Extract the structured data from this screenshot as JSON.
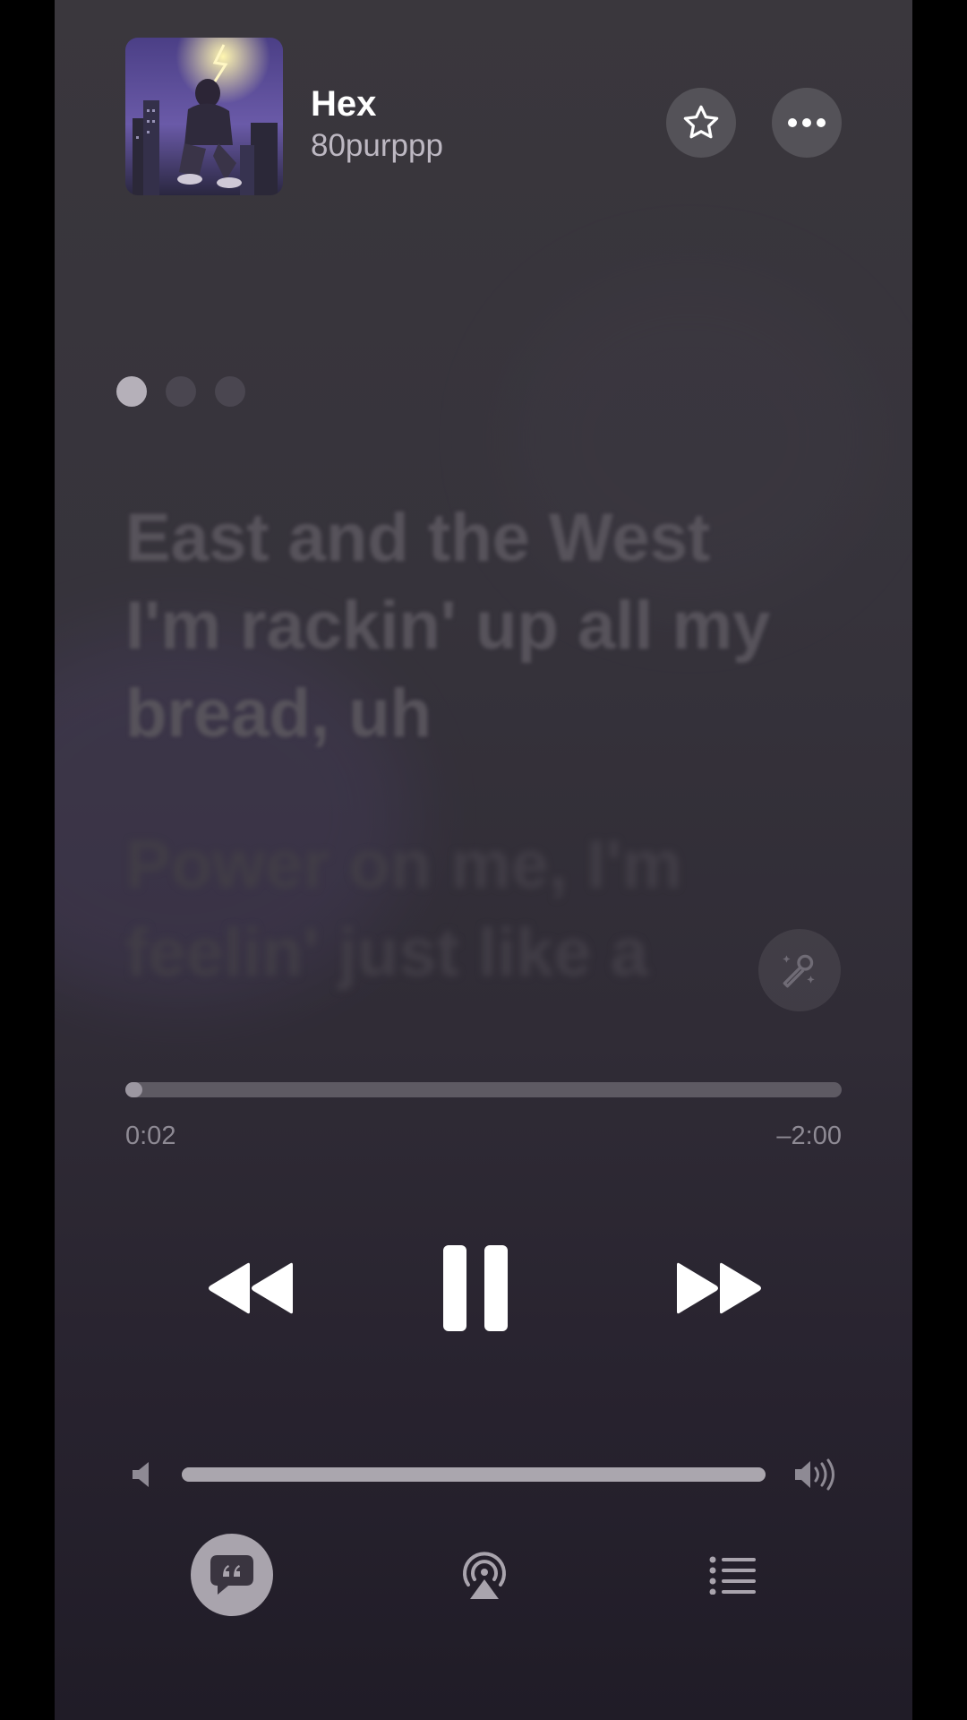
{
  "track": {
    "title": "Hex",
    "artist": "80purppp"
  },
  "header": {
    "favorite_icon": "star-icon",
    "more_icon": "ellipsis-icon"
  },
  "lyrics": {
    "current_line": "East and the West I'm rackin' up all my bread, uh",
    "next_line": "Power on me, I'm feelin' just like a"
  },
  "page_indicator": {
    "count": 3,
    "active_index": 0
  },
  "playback": {
    "elapsed": "0:02",
    "remaining": "–2:00",
    "progress_fraction": 0.02
  },
  "controls": {
    "previous_icon": "rewind-icon",
    "play_pause_icon": "pause-icon",
    "next_icon": "fast-forward-icon"
  },
  "volume": {
    "level_fraction": 1.0
  },
  "bottom_bar": {
    "lyrics_icon": "lyrics-quote-icon",
    "airplay_icon": "airplay-icon",
    "queue_icon": "queue-list-icon"
  },
  "colors": {
    "background": "#36333b",
    "accent_text": "#ffffff",
    "secondary_text": "#bdb8c2"
  }
}
